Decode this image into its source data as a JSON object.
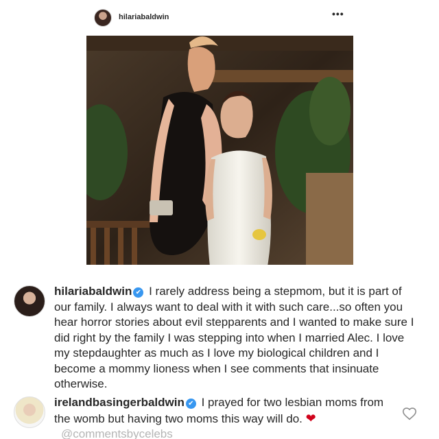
{
  "post": {
    "username": "hilariabaldwin",
    "more_label": "•••"
  },
  "comments": [
    {
      "username": "hilariabaldwin",
      "text": "I rarely address being a stepmom, but it is part of our family. I always want to deal with it with such care...so often you hear horror stories about evil stepparents and I wanted to make sure I did right by the family I was stepping into when I married Alec. I love my stepdaughter as much as I love my biological children and I become a mommy lioness when I see comments that insinuate otherwise."
    },
    {
      "username": "irelandbasingerbaldwin",
      "text": "I prayed for two lesbian moms from the womb but having two moms this way will do.",
      "emoji": "❤",
      "watermark": "@commentsbycelebs"
    }
  ],
  "icons": {
    "verified": "✔",
    "like": "heart-outline-icon"
  },
  "colors": {
    "verified_blue": "#3897f0",
    "text": "#262626",
    "watermark": "#b5b5b5",
    "heart_red": "#d0021b"
  }
}
